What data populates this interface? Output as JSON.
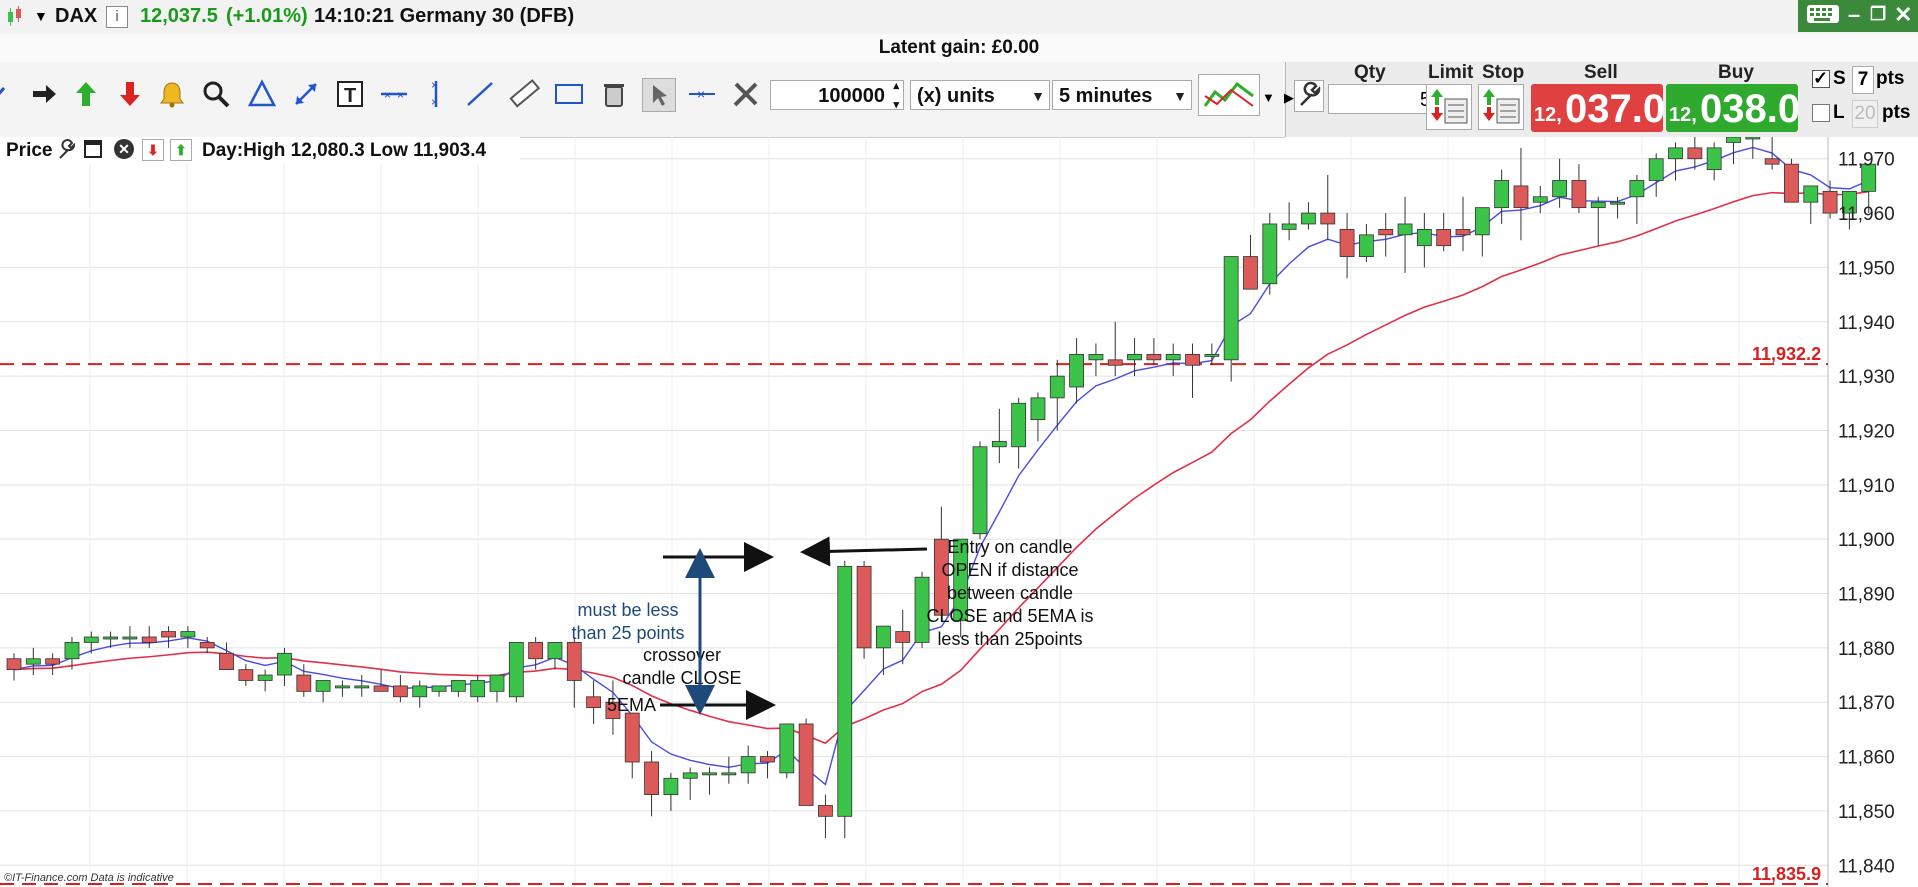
{
  "titlebar": {
    "instrument": "DAX",
    "price": "12,037.5",
    "change": "(+1.01%)",
    "time_market": "14:10:21 Germany 30 (DFB)"
  },
  "latent_gain": "Latent gain:  £0.00",
  "toolbar": {
    "quantity": "100000",
    "units": "(x) units",
    "interval": "5 minutes"
  },
  "deal": {
    "qty_label": "Qty",
    "qty_value": "5",
    "limit_label": "Limit",
    "stop_label": "Stop",
    "sell_label": "Sell",
    "buy_label": "Buy",
    "sell_small": "12,",
    "sell_big": "037.0",
    "buy_small": "12,",
    "buy_big": "038.0",
    "s_label": "S",
    "s_value": "7",
    "s_unit": "pts",
    "l_label": "L",
    "l_value": "20",
    "l_unit": "pts"
  },
  "price_header": {
    "label": "Price",
    "day_range": "Day:High 12,080.3 Low 11,903.4"
  },
  "watermark": "©IT-Finance.com  Data is indicative",
  "colors": {
    "up": "#3cc44a",
    "down": "#dd5a5a",
    "ema_fast": "#4a4ae6",
    "ema_slow": "#e0304a",
    "level_line": "#d92020",
    "arrow_blue": "#1e4a7a",
    "sell": "#e04040",
    "buy": "#2faa2f"
  },
  "chart_data": {
    "type": "candlestick",
    "ylim": [
      11836,
      11974
    ],
    "y_ticks": [
      "11,840",
      "11,850",
      "11,860",
      "11,870",
      "11,880",
      "11,890",
      "11,900",
      "11,910",
      "11,920",
      "11,930",
      "11,940",
      "11,950",
      "11,960",
      "11,970"
    ],
    "tick_values": [
      11840,
      11850,
      11860,
      11870,
      11880,
      11890,
      11900,
      11910,
      11920,
      11930,
      11940,
      11950,
      11960,
      11970
    ],
    "levels": [
      {
        "value": 11932.2,
        "label": "11,932.2"
      },
      {
        "value": 11835.9,
        "label": "11,835.9"
      }
    ],
    "candles": [
      [
        11878,
        11879,
        11874,
        11876
      ],
      [
        11877,
        11880,
        11875,
        11878
      ],
      [
        11878,
        11879,
        11875,
        11877
      ],
      [
        11878,
        11882,
        11876,
        11881
      ],
      [
        11881,
        11883,
        11879,
        11882
      ],
      [
        11882,
        11883,
        11880,
        11882
      ],
      [
        11882,
        11884,
        11880,
        11882
      ],
      [
        11882,
        11884,
        11880,
        11881
      ],
      [
        11883,
        11884,
        11880,
        11882
      ],
      [
        11882,
        11884,
        11880,
        11883
      ],
      [
        11881,
        11882,
        11879,
        11880
      ],
      [
        11879,
        11881,
        11876,
        11876
      ],
      [
        11876,
        11877,
        11873,
        11874
      ],
      [
        11874,
        11876,
        11872,
        11875
      ],
      [
        11875,
        11880,
        11873,
        11879
      ],
      [
        11875,
        11877,
        11871,
        11872
      ],
      [
        11872,
        11874,
        11870,
        11874
      ],
      [
        11873,
        11874,
        11871,
        11873
      ],
      [
        11873,
        11875,
        11871,
        11873
      ],
      [
        11873,
        11876,
        11872,
        11872
      ],
      [
        11873,
        11875,
        11870,
        11871
      ],
      [
        11871,
        11874,
        11869,
        11873
      ],
      [
        11872,
        11873,
        11871,
        11873
      ],
      [
        11872,
        11874,
        11871,
        11874
      ],
      [
        11871,
        11875,
        11870,
        11874
      ],
      [
        11872,
        11874,
        11870,
        11875
      ],
      [
        11871,
        11881,
        11870,
        11881
      ],
      [
        11881,
        11882,
        11876,
        11878
      ],
      [
        11878,
        11881,
        11876,
        11881
      ],
      [
        11881,
        11882,
        11869,
        11874
      ],
      [
        11871,
        11874,
        11866,
        11869
      ],
      [
        11870,
        11874,
        11864,
        11867
      ],
      [
        11868,
        11868,
        11856,
        11859
      ],
      [
        11859,
        11861,
        11849,
        11853
      ],
      [
        11853,
        11857,
        11850,
        11856
      ],
      [
        11856,
        11858,
        11852,
        11857
      ],
      [
        11857,
        11858,
        11853,
        11857
      ],
      [
        11857,
        11860,
        11855,
        11857
      ],
      [
        11857,
        11862,
        11855,
        11860
      ],
      [
        11860,
        11861,
        11856,
        11859
      ],
      [
        11857,
        11863,
        11856,
        11866
      ],
      [
        11866,
        11867,
        11852,
        11851
      ],
      [
        11851,
        11853,
        11845,
        11849
      ],
      [
        11849,
        11896,
        11845,
        11895
      ],
      [
        11895,
        11896,
        11878,
        11880
      ],
      [
        11880,
        11884,
        11875,
        11884
      ],
      [
        11883,
        11887,
        11877,
        11881
      ],
      [
        11881,
        11894,
        11880,
        11893
      ],
      [
        11900,
        11906,
        11885,
        11886
      ],
      [
        11885,
        11900,
        11882,
        11900
      ],
      [
        11901,
        11918,
        11900,
        11917
      ],
      [
        11917,
        11924,
        11914,
        11918
      ],
      [
        11917,
        11926,
        11913,
        11925
      ],
      [
        11922,
        11927,
        11918,
        11926
      ],
      [
        11926,
        11933,
        11920,
        11930
      ],
      [
        11928,
        11937,
        11925,
        11934
      ],
      [
        11933,
        11936,
        11930,
        11934
      ],
      [
        11933,
        11940,
        11930,
        11932
      ],
      [
        11933,
        11937,
        11930,
        11934
      ],
      [
        11934,
        11937,
        11932,
        11933
      ],
      [
        11933,
        11936,
        11930,
        11934
      ],
      [
        11934,
        11936,
        11926,
        11932
      ],
      [
        11934,
        11936,
        11932,
        11934
      ],
      [
        11933,
        11939,
        11929,
        11952
      ],
      [
        11952,
        11956,
        11948,
        11946
      ],
      [
        11947,
        11960,
        11945,
        11958
      ],
      [
        11957,
        11962,
        11955,
        11958
      ],
      [
        11958,
        11962,
        11957,
        11960
      ],
      [
        11960,
        11967,
        11955,
        11958
      ],
      [
        11957,
        11960,
        11948,
        11952
      ],
      [
        11952,
        11958,
        11951,
        11956
      ],
      [
        11957,
        11960,
        11952,
        11956
      ],
      [
        11956,
        11963,
        11949,
        11958
      ],
      [
        11954,
        11960,
        11950,
        11957
      ],
      [
        11957,
        11960,
        11953,
        11954
      ],
      [
        11957,
        11963,
        11953,
        11956
      ],
      [
        11956,
        11961,
        11952,
        11961
      ],
      [
        11961,
        11968,
        11958,
        11966
      ],
      [
        11965,
        11972,
        11955,
        11961
      ],
      [
        11962,
        11965,
        11960,
        11963
      ],
      [
        11963,
        11970,
        11961,
        11966
      ],
      [
        11966,
        11969,
        11960,
        11961
      ],
      [
        11961,
        11963,
        11954,
        11962
      ],
      [
        11962,
        11963,
        11959,
        11962
      ],
      [
        11963,
        11967,
        11958,
        11966
      ],
      [
        11966,
        11971,
        11963,
        11970
      ],
      [
        11970,
        11973,
        11966,
        11972
      ],
      [
        11972,
        11974,
        11968,
        11970
      ],
      [
        11968,
        11973,
        11966,
        11972
      ],
      [
        11973,
        11974,
        11969,
        11974
      ],
      [
        11974,
        11974,
        11970,
        11974
      ],
      [
        11970,
        11974,
        11968,
        11969
      ],
      [
        11969,
        11970,
        11964,
        11962
      ],
      [
        11962,
        11963,
        11958,
        11965
      ],
      [
        11964,
        11966,
        11959,
        11960
      ],
      [
        11960,
        11964,
        11957,
        11964
      ],
      [
        11964,
        11968,
        11960,
        11969
      ]
    ],
    "annotations": {
      "crossover": [
        "crossover",
        "candle CLOSE"
      ],
      "rule": [
        "must be less",
        "than 25 points"
      ],
      "ema": "5EMA",
      "entry": [
        "Entry on candle",
        "OPEN if distance",
        "between candle",
        "CLOSE and 5EMA is",
        "less than 25points"
      ]
    }
  }
}
